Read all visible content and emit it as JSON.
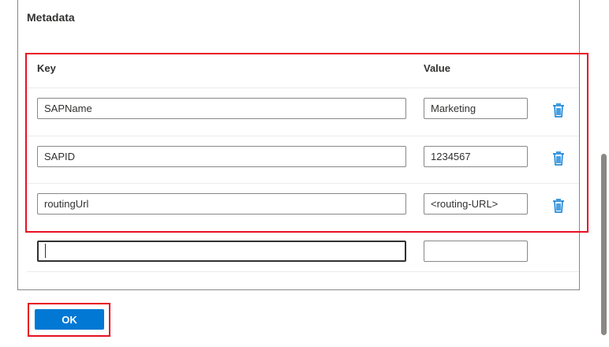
{
  "metadata": {
    "title": "Metadata",
    "columns": {
      "key": "Key",
      "value": "Value"
    },
    "rows": [
      {
        "key": "SAPName",
        "value": "Marketing"
      },
      {
        "key": "SAPID",
        "value": "1234567"
      },
      {
        "key": "routingUrl",
        "value": "<routing-URL>"
      }
    ],
    "new_row": {
      "key": "",
      "value": ""
    }
  },
  "footer": {
    "ok_label": "OK"
  },
  "colors": {
    "primary": "#0078d4",
    "highlight": "#e81123",
    "delete_icon": "#0078d4"
  },
  "icons": {
    "delete": "trash-icon"
  }
}
